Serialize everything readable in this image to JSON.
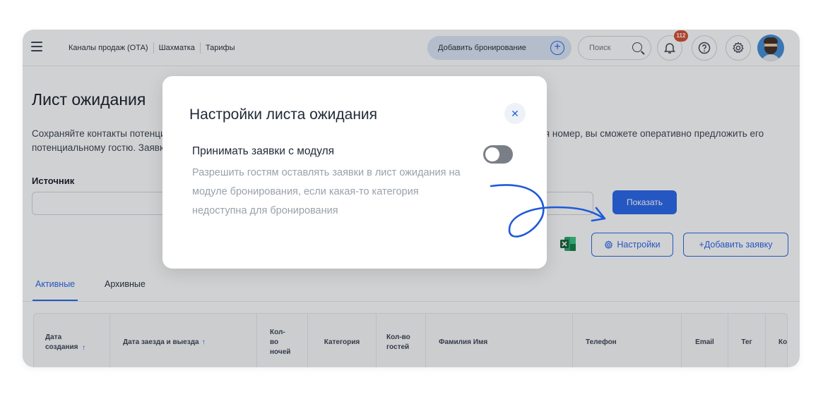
{
  "header": {
    "nav": [
      "Каналы продаж (ОТА)",
      "Шахматка",
      "Тарифы"
    ],
    "add_booking": "Добавить бронирование",
    "search_placeholder": "Поиск",
    "notification_count": "112"
  },
  "page": {
    "title": "Лист ожидания",
    "description": "Сохраняйте контакты потенциальных гостей, если на нужные даты нет свободных номеров. Как только освободится номер, вы сможете оперативно предложить его потенциальному гостю. Заявки могут поступать с модуля бронирования, либо вы можете внести заявку вручную",
    "source_label": "Источник",
    "show_button": "Показать",
    "settings_button": "Настройки",
    "add_request_button": "+Добавить заявку",
    "tabs": [
      "Активные",
      "Архивные"
    ],
    "columns": [
      "Дата создания",
      "Дата заезда и выезда",
      "Кол-во ночей",
      "Категория",
      "Кол-во гостей",
      "Фамилия Имя",
      "Телефон",
      "Email",
      "Тег",
      "Ко"
    ]
  },
  "modal": {
    "title": "Настройки листа ожидания",
    "option_title": "Принимать заявки с модуля",
    "option_description": "Разрешить гостям оставлять заявки в лист ожидания на модуле бронирования, если какая-то категория недоступна для бронирования",
    "toggle_on": false
  },
  "colors": {
    "accent": "#2563eb",
    "badge": "#d24b2c",
    "toggle_off": "#7a7f87"
  }
}
